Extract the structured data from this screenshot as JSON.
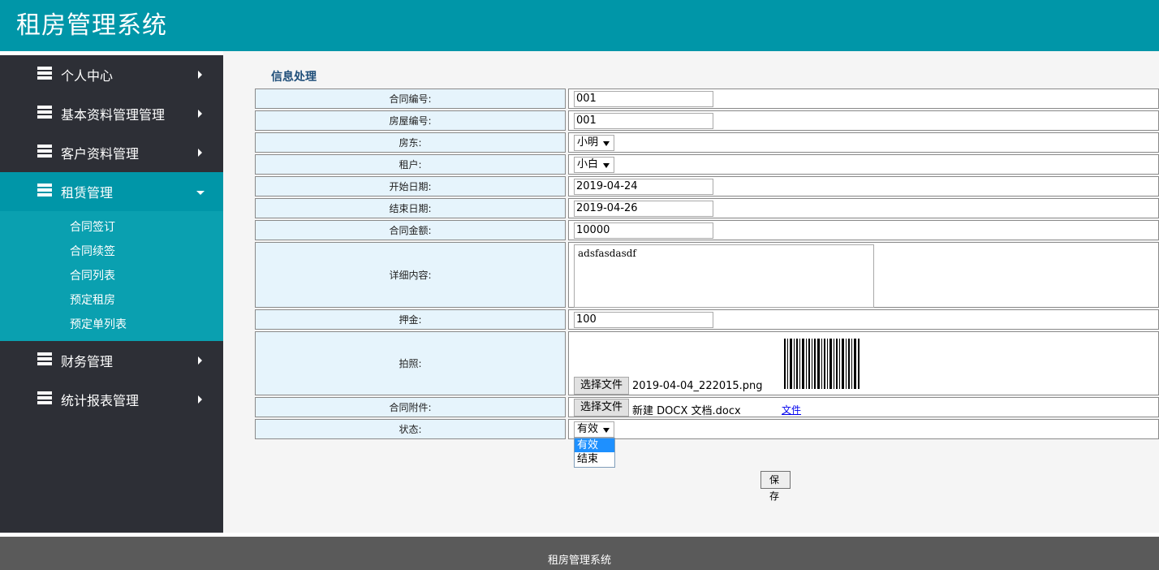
{
  "header": {
    "title": "租房管理系统"
  },
  "sidebar": {
    "items": [
      {
        "label": "个人中心"
      },
      {
        "label": "基本资料管理管理"
      },
      {
        "label": "客户资料管理"
      },
      {
        "label": "租赁管理"
      },
      {
        "label": "财务管理"
      },
      {
        "label": "统计报表管理"
      }
    ],
    "submenu": [
      {
        "label": "合同签订"
      },
      {
        "label": "合同续签"
      },
      {
        "label": "合同列表"
      },
      {
        "label": "预定租房"
      },
      {
        "label": "预定单列表"
      }
    ]
  },
  "main": {
    "section_title": "信息处理",
    "fields": {
      "contract_no": {
        "label": "合同编号:",
        "value": "001"
      },
      "house_no": {
        "label": "房屋编号:",
        "value": "001"
      },
      "landlord": {
        "label": "房东:",
        "value": "小明"
      },
      "tenant": {
        "label": "租户:",
        "value": "小白"
      },
      "start_date": {
        "label": "开始日期:",
        "value": "2019-04-24"
      },
      "end_date": {
        "label": "结束日期:",
        "value": "2019-04-26"
      },
      "amount": {
        "label": "合同金额:",
        "value": "10000"
      },
      "details": {
        "label": "详细内容:",
        "value": "adsfasdasdf"
      },
      "deposit": {
        "label": "押金:",
        "value": "100"
      },
      "photo": {
        "label": "拍照:",
        "button": "选择文件",
        "filename": "2019-04-04_222015.png"
      },
      "attachment": {
        "label": "合同附件:",
        "button": "选择文件",
        "filename": "新建 DOCX 文档.docx",
        "link": "文件"
      },
      "status": {
        "label": "状态:",
        "value": "有效",
        "options": [
          "有效",
          "结束"
        ]
      }
    },
    "save_label": "保 存"
  },
  "footer": {
    "text": "租房管理系统"
  }
}
